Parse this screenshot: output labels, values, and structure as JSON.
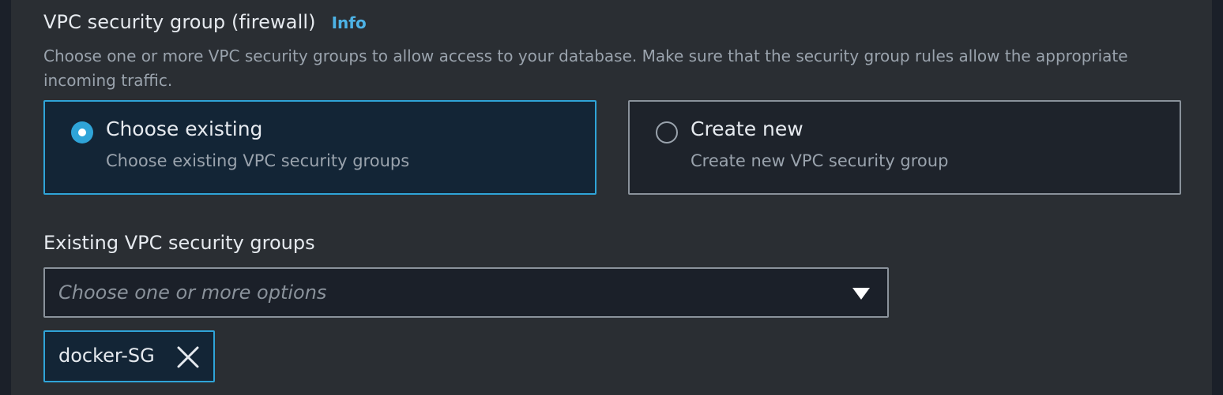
{
  "section": {
    "title": "VPC security group (firewall)",
    "info_link": "Info",
    "description": "Choose one or more VPC security groups to allow access to your database. Make sure that the security group rules allow the appropriate incoming traffic."
  },
  "options": [
    {
      "label": "Choose existing",
      "sublabel": "Choose existing VPC security groups",
      "selected": true
    },
    {
      "label": "Create new",
      "sublabel": "Create new VPC security group",
      "selected": false
    }
  ],
  "existing_groups": {
    "label": "Existing VPC security groups",
    "placeholder": "Choose one or more options",
    "dropdown_icon": "caret-down-icon",
    "selected_tokens": [
      {
        "label": "docker-SG",
        "remove_icon": "close-icon"
      }
    ]
  },
  "colors": {
    "accent": "#2fa4d8",
    "info_link": "#4db3e6",
    "panel_background": "#2a2e33",
    "selected_tile_background": "#132536"
  }
}
